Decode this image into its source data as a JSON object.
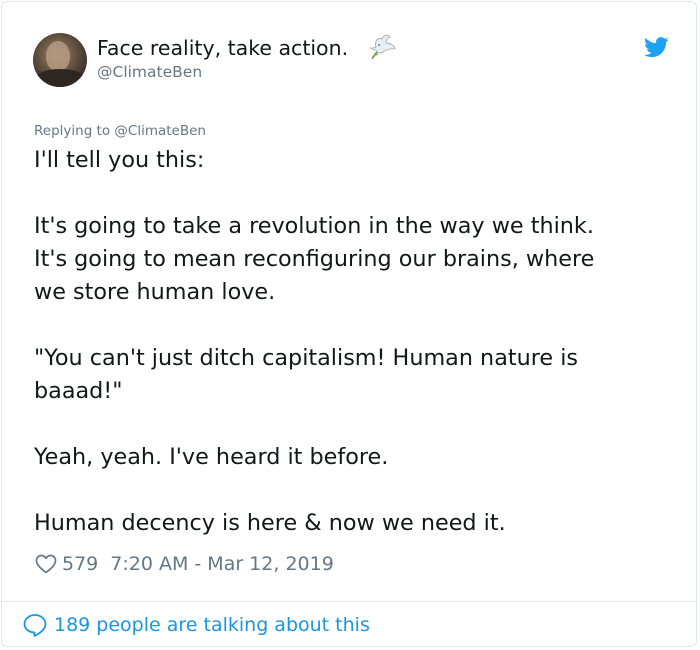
{
  "tweet": {
    "author": {
      "display_name": "Face reality, take action.",
      "handle": "@ClimateBen",
      "avatar_icon": "avatar-photo",
      "name_emoji_icon": "dove-of-peace-icon"
    },
    "brand_icon": "twitter-bird-icon",
    "replying_to": {
      "prefix": "Replying to",
      "mention": "@ClimateBen"
    },
    "text_lines": [
      "I'll tell you this:",
      "",
      "It's going to take a revolution in the way we think.",
      "It's going to mean reconfiguring our brains, where",
      "we store human love.",
      "",
      "\"You can't just ditch capitalism! Human nature is",
      "baaad!\"",
      "",
      "Yeah, yeah. I've heard it before.",
      "",
      "Human decency is here & now we need it."
    ],
    "likes": "579",
    "timestamp": "7:20 AM - Mar 12, 2019",
    "footer": {
      "label": "189 people are talking about this",
      "icon": "speech-bubble-icon"
    }
  },
  "colors": {
    "text": "#14171a",
    "secondary": "#657786",
    "link": "#1b95e0",
    "twitter_blue": "#1da1f2",
    "border": "#e1e8ed"
  }
}
